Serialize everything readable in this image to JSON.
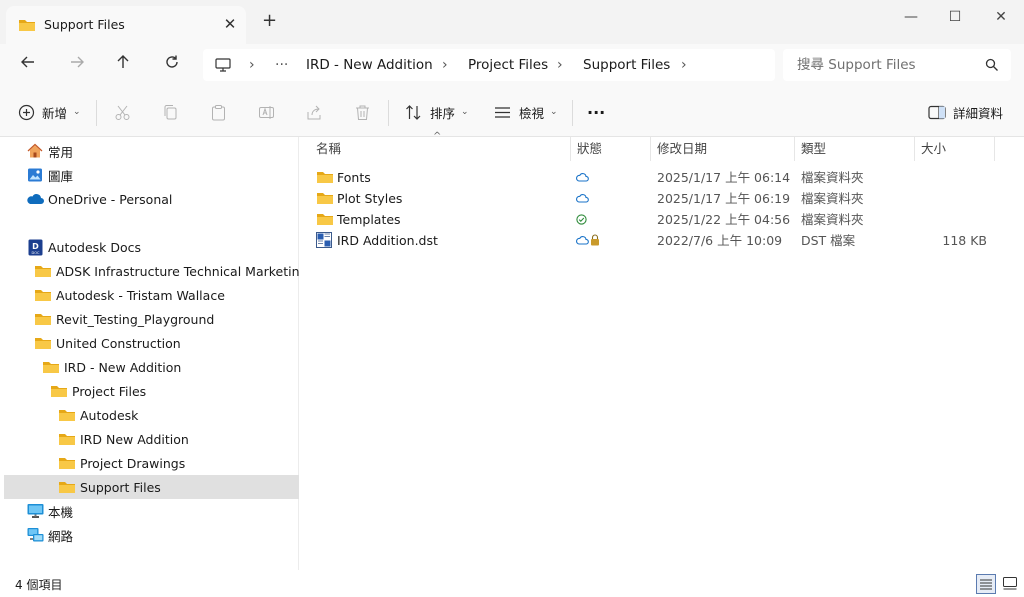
{
  "window": {
    "tab_title": "Support Files",
    "tab_close": "✕",
    "new_tab": "+",
    "minimize": "—",
    "maximize": "☐",
    "close": "✕"
  },
  "nav": {
    "breadcrumb": [
      "IRD - New Addition",
      "Project Files",
      "Support Files"
    ],
    "overflow": "···",
    "search_placeholder": "搜尋 Support Files"
  },
  "toolbar": {
    "new_label": "新增",
    "sort_label": "排序",
    "view_label": "檢視",
    "more": "···",
    "details_label": "詳細資料"
  },
  "sidebar": {
    "items": [
      {
        "label": "常用",
        "icon": "home-icon"
      },
      {
        "label": "圖庫",
        "icon": "gallery-icon"
      },
      {
        "label": "OneDrive - Personal",
        "icon": "onedrive-cloud-icon"
      },
      {
        "label": "Autodesk Docs",
        "icon": "autodesk-docs-icon"
      },
      {
        "label": "ADSK Infrastructure Technical Marketing",
        "icon": "folder-icon"
      },
      {
        "label": "Autodesk - Tristam Wallace",
        "icon": "folder-icon"
      },
      {
        "label": "Revit_Testing_Playground",
        "icon": "folder-icon"
      },
      {
        "label": "United Construction",
        "icon": "folder-icon"
      },
      {
        "label": "IRD - New Addition",
        "icon": "folder-icon"
      },
      {
        "label": "Project Files",
        "icon": "folder-icon"
      },
      {
        "label": "Autodesk",
        "icon": "folder-icon"
      },
      {
        "label": "IRD New Addition",
        "icon": "folder-icon"
      },
      {
        "label": "Project Drawings",
        "icon": "folder-icon"
      },
      {
        "label": "Support Files",
        "icon": "folder-icon"
      },
      {
        "label": "本機",
        "icon": "this-pc-icon"
      },
      {
        "label": "網路",
        "icon": "network-icon"
      }
    ]
  },
  "columns": {
    "name": "名稱",
    "status": "狀態",
    "modified": "修改日期",
    "type": "類型",
    "size": "大小",
    "sort_arrow": "^"
  },
  "files": [
    {
      "name": "Fonts",
      "status": "cloud",
      "modified": "2025/1/17 上午 06:14",
      "type": "檔案資料夾",
      "size": ""
    },
    {
      "name": "Plot Styles",
      "status": "cloud",
      "modified": "2025/1/17 上午 06:19",
      "type": "檔案資料夾",
      "size": ""
    },
    {
      "name": "Templates",
      "status": "synced",
      "modified": "2025/1/22 上午 04:56",
      "type": "檔案資料夾",
      "size": ""
    },
    {
      "name": "IRD Addition.dst",
      "status": "cloud-locked",
      "modified": "2022/7/6 上午 10:09",
      "type": "DST 檔案",
      "size": "118 KB"
    }
  ],
  "status": {
    "count": "4 個項目"
  },
  "colors": {
    "folder": "#f8c846",
    "folder_dark": "#e6a817",
    "cloud": "#1a73c8",
    "synced": "#2e8b3a",
    "selected": "#e0e0e0"
  }
}
